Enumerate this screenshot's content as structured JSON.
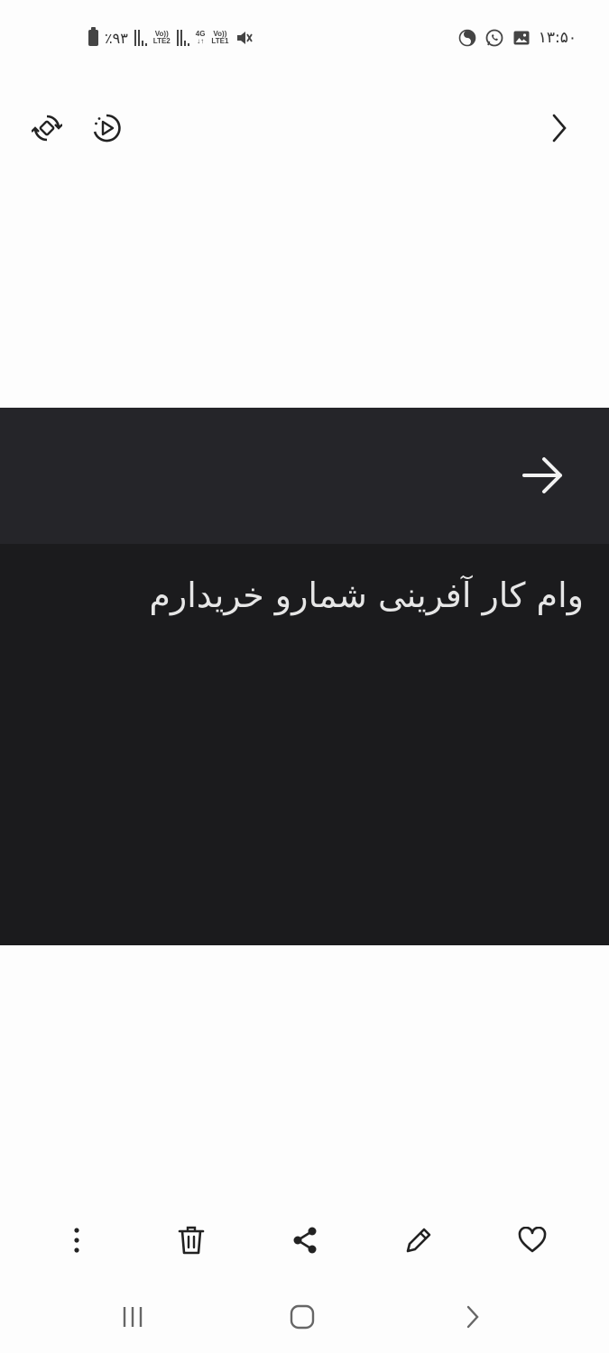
{
  "status_bar": {
    "time": "۱۳:۵۰",
    "battery": "٪۹۳",
    "network_1_top": "Vo))",
    "network_1_bottom": "LTE2",
    "network_2_top": "4G",
    "network_2_bottom": "↓↑",
    "network_3_top": "Vo))",
    "network_3_bottom": "LTE1"
  },
  "top_toolbar": {
    "icons": [
      "rotate-icon",
      "motion-photo-icon",
      "chevron-right-icon"
    ]
  },
  "image": {
    "message_text": "وام کار آفرینی شمارو خریدارم",
    "header_color": "#252529",
    "body_color": "#1b1b1d",
    "arrow_icon": "arrow-right-icon"
  },
  "bottom_toolbar": {
    "icons": [
      "more-vertical-icon",
      "trash-icon",
      "share-icon",
      "edit-icon",
      "heart-icon"
    ]
  },
  "nav_bar": {
    "icons": [
      "recents-icon",
      "home-icon",
      "back-icon"
    ]
  }
}
